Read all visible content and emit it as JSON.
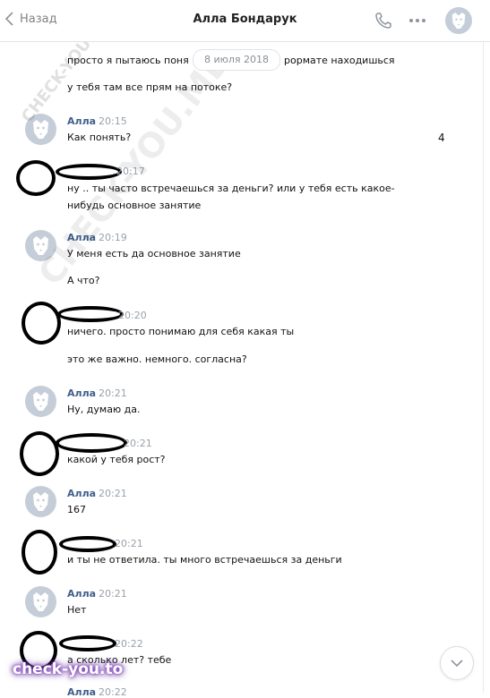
{
  "header": {
    "back_label": "Назад",
    "title": "Алла Бондарук"
  },
  "date_pill": "8 июля 2018",
  "badge": "4",
  "messages": [
    {
      "text": "просто я пытаюсь поня"
    },
    {
      "text": "рормате находишься"
    },
    {
      "text": "у тебя там все прям на потоке?"
    },
    {
      "name": "Алла",
      "time": "20:15",
      "text": "Как понять?"
    },
    {
      "time": "20:17",
      "text": "ну .. ты часто встречаешься за деньги? или у тебя есть какое-нибудь основное занятие"
    },
    {
      "name": "Алла",
      "time": "20:19",
      "text": "У меня есть да основное занятие"
    },
    {
      "text": "А что?"
    },
    {
      "time": "20:20",
      "text": "ничего. просто понимаю для себя какая ты"
    },
    {
      "text": "это же важно. немного. согласна?"
    },
    {
      "name": "Алла",
      "time": "20:21",
      "text": "Ну, думаю да."
    },
    {
      "time": "20:21",
      "text": "какой у тебя рост?"
    },
    {
      "name": "Алла",
      "time": "20:21",
      "text": "167"
    },
    {
      "time": "20:21",
      "text": "и ты не ответила. ты много встречаешься за деньги"
    },
    {
      "name": "Алла",
      "time": "20:21",
      "text": "Нет"
    },
    {
      "time": "20:22",
      "text": "а сколько лет? тебе"
    },
    {
      "name": "Алла",
      "time": "20:22"
    }
  ],
  "watermarks": {
    "small": "CHECK-YOU.ME",
    "large": "CHECK-YOU.ME",
    "logo": "check-you.to"
  },
  "icons": {
    "back": "chevron-left-icon",
    "call": "phone-icon",
    "more": "more-dots-icon",
    "scroll": "chevron-down-icon",
    "avatar": "dog-avatar-icon"
  },
  "colors": {
    "name": "#3f5f89",
    "time": "#9aa1a9",
    "avatar_bg": "#c4cdd8"
  }
}
